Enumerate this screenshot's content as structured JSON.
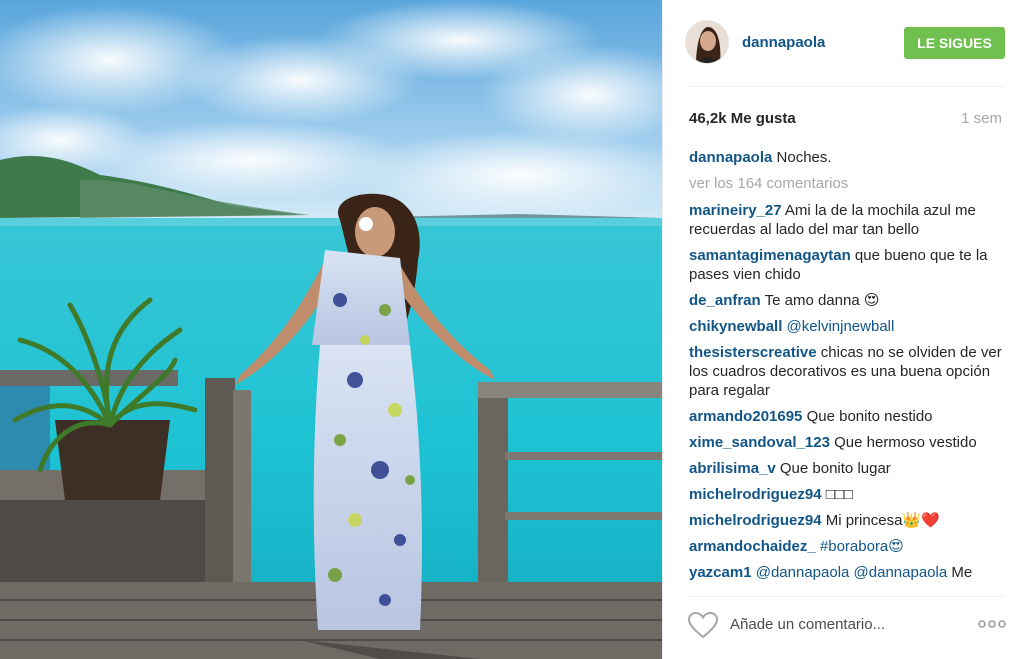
{
  "post": {
    "author": "dannapaola",
    "follow_label": "LE SIGUES",
    "likes": "46,2k Me gusta",
    "time": "1 sem",
    "caption_user": "dannapaola",
    "caption_text": "Noches.",
    "view_comments": "ver los 164 comentarios"
  },
  "comments": [
    {
      "user": "marineiry_27",
      "text": "Ami la de la mochila azul me recuerdas al lado del mar tan bello"
    },
    {
      "user": "samantagimenagaytan",
      "text": "que bueno que te la pases vien chido"
    },
    {
      "user": "de_anfran",
      "text": "Te amo danna 😍"
    },
    {
      "user": "chikynewball",
      "text": "@kelvinjnewball"
    },
    {
      "user": "thesisterscreative",
      "text": "chicas no se olviden de ver los cuadros decorativos es una buena opción para regalar"
    },
    {
      "user": "armando201695",
      "text": "Que bonito nestido"
    },
    {
      "user": "xime_sandoval_123",
      "text": "Que hermoso vestido"
    },
    {
      "user": "abrilisima_v",
      "text": "Que bonito lugar"
    },
    {
      "user": "michelrodriguez94",
      "text": "□□□"
    },
    {
      "user": "michelrodriguez94",
      "text": "Mi princesa👑❤️"
    },
    {
      "user": "armandochaidez_",
      "text": "#borabora😍"
    },
    {
      "user": "yazcam1",
      "text": "@dannapaola @dannapaola Me"
    }
  ],
  "footer": {
    "comment_placeholder": "Añade un comentario...",
    "heart_icon": "heart-outline-icon",
    "more_icon": "more-options-icon"
  },
  "colors": {
    "link": "#125688",
    "follow": "#70c050",
    "muted": "#a5a7aa"
  }
}
